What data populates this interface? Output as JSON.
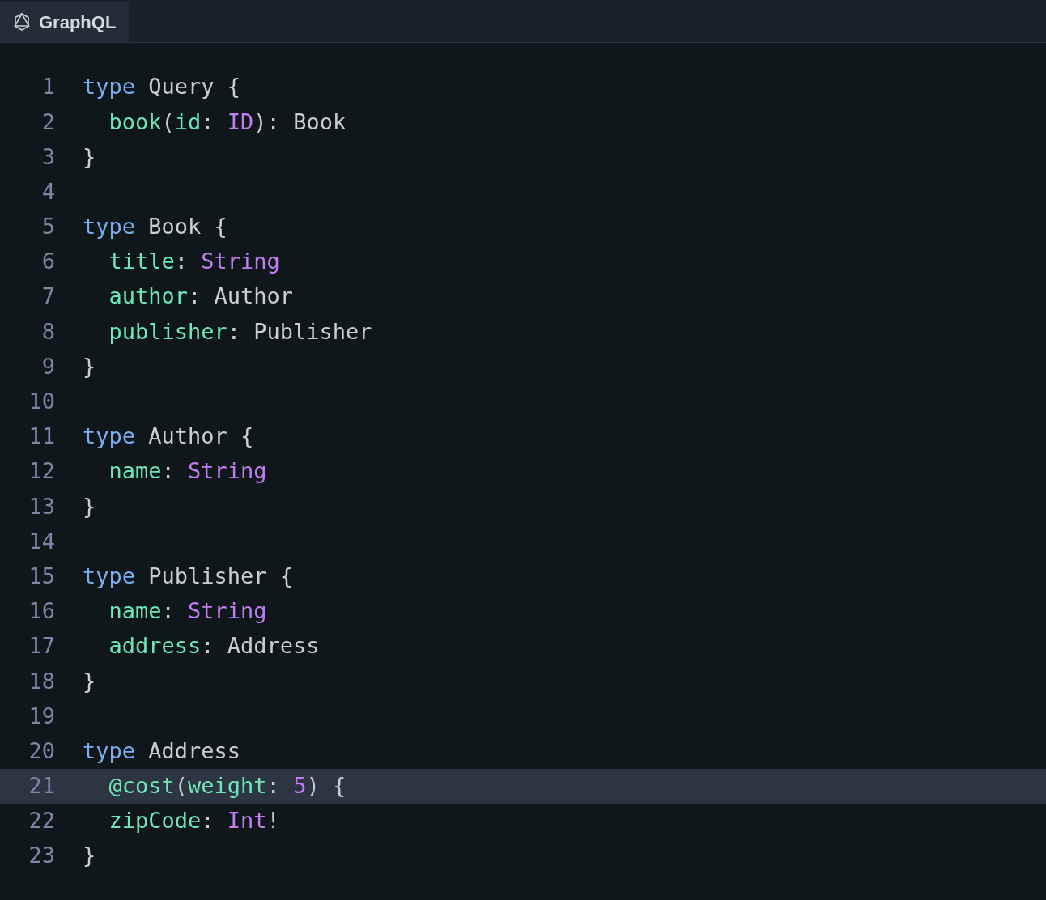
{
  "tabs": [
    {
      "label": "GraphQL",
      "selected": true
    }
  ],
  "lines": [
    {
      "number": "1",
      "highlighted": false,
      "tokens": [
        {
          "text": "type",
          "kind": "keyword"
        },
        {
          "text": " Query {",
          "kind": "plain"
        }
      ]
    },
    {
      "number": "2",
      "highlighted": false,
      "tokens": [
        {
          "text": "  book",
          "kind": "field"
        },
        {
          "text": "(",
          "kind": "plain"
        },
        {
          "text": "id",
          "kind": "field"
        },
        {
          "text": ": ",
          "kind": "plain"
        },
        {
          "text": "ID",
          "kind": "type"
        },
        {
          "text": "): Book",
          "kind": "plain"
        }
      ]
    },
    {
      "number": "3",
      "highlighted": false,
      "tokens": [
        {
          "text": "}",
          "kind": "plain"
        }
      ]
    },
    {
      "number": "4",
      "highlighted": false
    },
    {
      "number": "5",
      "highlighted": false,
      "tokens": [
        {
          "text": "type",
          "kind": "keyword"
        },
        {
          "text": " Book {",
          "kind": "plain"
        }
      ]
    },
    {
      "number": "6",
      "highlighted": false,
      "tokens": [
        {
          "text": "  title",
          "kind": "field"
        },
        {
          "text": ": ",
          "kind": "plain"
        },
        {
          "text": "String",
          "kind": "type"
        }
      ]
    },
    {
      "number": "7",
      "highlighted": false,
      "tokens": [
        {
          "text": "  author",
          "kind": "field"
        },
        {
          "text": ": Author",
          "kind": "plain"
        }
      ]
    },
    {
      "number": "8",
      "highlighted": false,
      "tokens": [
        {
          "text": "  publisher",
          "kind": "field"
        },
        {
          "text": ": Publisher",
          "kind": "plain"
        }
      ]
    },
    {
      "number": "9",
      "highlighted": false,
      "tokens": [
        {
          "text": "}",
          "kind": "plain"
        }
      ]
    },
    {
      "number": "10",
      "highlighted": false
    },
    {
      "number": "11",
      "highlighted": false,
      "tokens": [
        {
          "text": "type",
          "kind": "keyword"
        },
        {
          "text": " Author {",
          "kind": "plain"
        }
      ]
    },
    {
      "number": "12",
      "highlighted": false,
      "tokens": [
        {
          "text": "  name",
          "kind": "field"
        },
        {
          "text": ": ",
          "kind": "plain"
        },
        {
          "text": "String",
          "kind": "type"
        }
      ]
    },
    {
      "number": "13",
      "highlighted": false,
      "tokens": [
        {
          "text": "}",
          "kind": "plain"
        }
      ]
    },
    {
      "number": "14",
      "highlighted": false
    },
    {
      "number": "15",
      "highlighted": false,
      "tokens": [
        {
          "text": "type",
          "kind": "keyword"
        },
        {
          "text": " Publisher {",
          "kind": "plain"
        }
      ]
    },
    {
      "number": "16",
      "highlighted": false,
      "tokens": [
        {
          "text": "  name",
          "kind": "field"
        },
        {
          "text": ": ",
          "kind": "plain"
        },
        {
          "text": "String",
          "kind": "type"
        }
      ]
    },
    {
      "number": "17",
      "highlighted": false,
      "tokens": [
        {
          "text": "  address",
          "kind": "field"
        },
        {
          "text": ": Address",
          "kind": "plain"
        }
      ]
    },
    {
      "number": "18",
      "highlighted": false,
      "tokens": [
        {
          "text": "}",
          "kind": "plain"
        }
      ]
    },
    {
      "number": "19",
      "highlighted": false
    },
    {
      "number": "20",
      "highlighted": false,
      "tokens": [
        {
          "text": "type",
          "kind": "keyword"
        },
        {
          "text": " Address",
          "kind": "plain"
        }
      ]
    },
    {
      "number": "21",
      "highlighted": true,
      "tokens": [
        {
          "text": "  @cost",
          "kind": "field"
        },
        {
          "text": "(",
          "kind": "plain"
        },
        {
          "text": "weight",
          "kind": "field"
        },
        {
          "text": ": ",
          "kind": "plain"
        },
        {
          "text": "5",
          "kind": "type"
        },
        {
          "text": ") {",
          "kind": "plain"
        }
      ]
    },
    {
      "number": "22",
      "highlighted": false,
      "tokens": [
        {
          "text": "  zipCode",
          "kind": "field"
        },
        {
          "text": ": ",
          "kind": "plain"
        },
        {
          "text": "Int",
          "kind": "type"
        },
        {
          "text": "!",
          "kind": "plain"
        }
      ]
    },
    {
      "number": "23",
      "highlighted": false,
      "tokens": [
        {
          "text": "}",
          "kind": "plain"
        }
      ]
    }
  ]
}
